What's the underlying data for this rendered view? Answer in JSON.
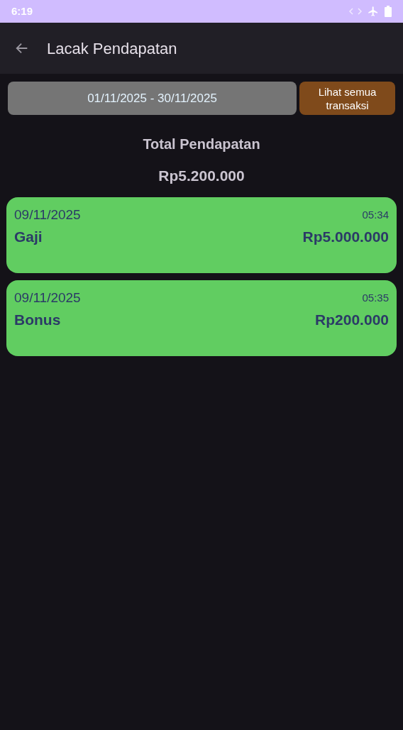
{
  "status_bar": {
    "time": "6:19"
  },
  "app_bar": {
    "title": "Lacak Pendapatan"
  },
  "date_range": "01/11/2025 - 30/11/2025",
  "all_transactions_button": "Lihat semua transaksi",
  "total": {
    "label": "Total Pendapatan",
    "amount": "Rp5.200.000"
  },
  "transactions": [
    {
      "date": "09/11/2025",
      "time": "05:34",
      "category": "Gaji",
      "amount": "Rp5.000.000"
    },
    {
      "date": "09/11/2025",
      "time": "05:35",
      "category": "Bonus",
      "amount": "Rp200.000"
    }
  ]
}
